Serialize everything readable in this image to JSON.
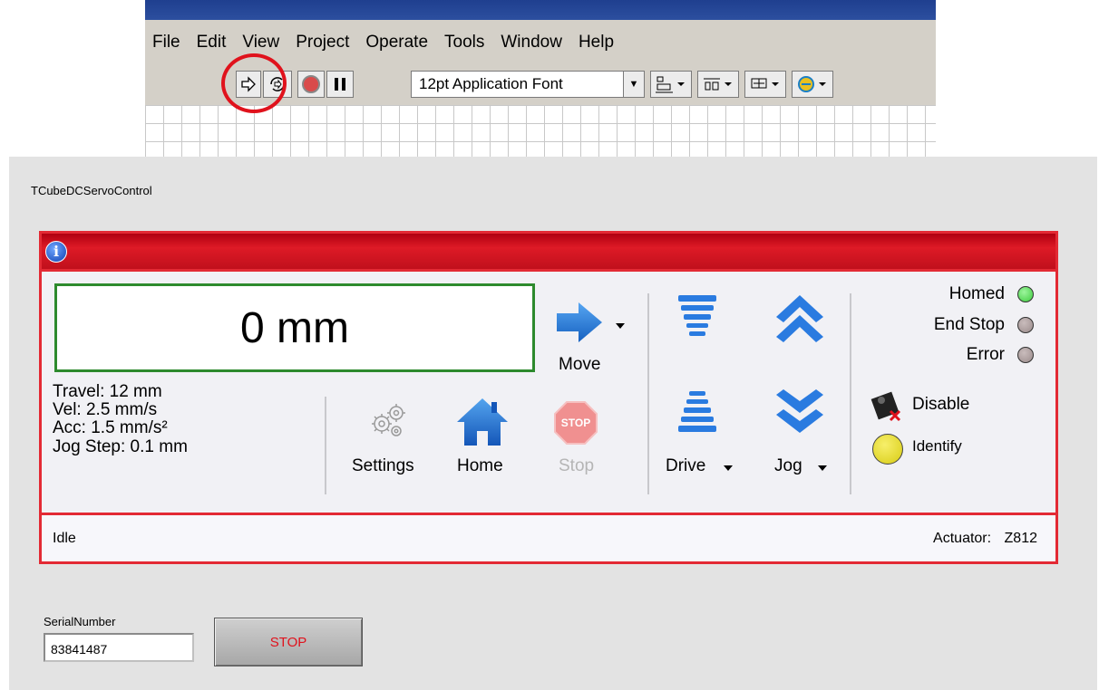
{
  "menubar": {
    "items": [
      "File",
      "Edit",
      "View",
      "Project",
      "Operate",
      "Tools",
      "Window",
      "Help"
    ]
  },
  "toolbar": {
    "font_select": "12pt Application Font",
    "buttons": [
      "run-icon",
      "run-continuously-icon",
      "abort-icon",
      "pause-icon",
      "align-objects-icon",
      "distribute-objects-icon",
      "resize-objects-icon",
      "reorder-icon"
    ]
  },
  "panel": {
    "control_title": "TCubeDCServoControl",
    "position": "0 mm",
    "info": {
      "travel": "Travel: 12 mm",
      "vel": "Vel: 2.5 mm/s",
      "acc": "Acc: 1.5 mm/s²",
      "jog_step": "Jog Step: 0.1 mm"
    },
    "buttons": {
      "move": "Move",
      "settings": "Settings",
      "home": "Home",
      "stop": "Stop",
      "stop_sign": "STOP",
      "drive": "Drive",
      "jog": "Jog",
      "disable": "Disable",
      "identify": "Identify"
    },
    "status_indicators": {
      "homed": "Homed",
      "end_stop": "End Stop",
      "error": "Error"
    },
    "status_text": "Idle",
    "actuator_label": "Actuator:",
    "actuator_value": "Z812"
  },
  "serial": {
    "label": "SerialNumber",
    "value": "83841487"
  },
  "stop_button": "STOP",
  "colors": {
    "header_red": "#de1a26",
    "border_red": "#e32a34",
    "display_green": "#2d8a2d",
    "led_green": "#3ecb3e",
    "led_off": "#9a8b8b",
    "identify_yellow": "#e6dc1c",
    "highlight_red": "#e0121c"
  }
}
